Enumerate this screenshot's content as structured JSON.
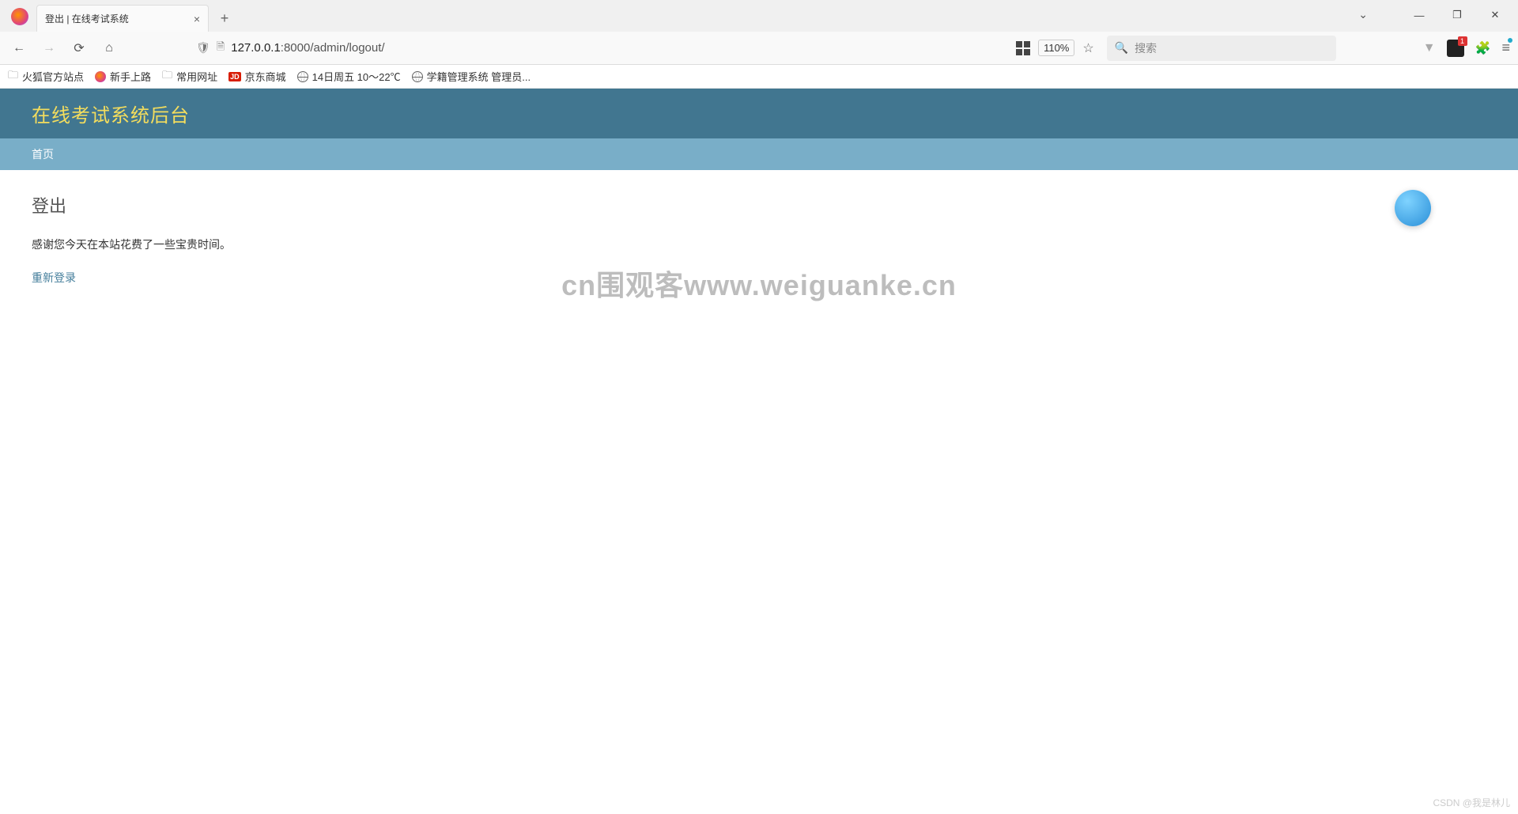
{
  "browser": {
    "tab_title": "登出 | 在线考试系统",
    "url_host": "127.0.0.1",
    "url_port_path": ":8000/admin/logout/",
    "zoom": "110%",
    "search_placeholder": "搜索",
    "ext_badge": "1"
  },
  "bookmarks": [
    {
      "label": "火狐官方站点",
      "type": "folder"
    },
    {
      "label": "新手上路",
      "type": "ff"
    },
    {
      "label": "常用网址",
      "type": "folder"
    },
    {
      "label": "京东商城",
      "type": "jd"
    },
    {
      "label": "14日周五  10～22℃",
      "type": "globe"
    },
    {
      "label": "学籍管理系统 管理员...",
      "type": "globe"
    }
  ],
  "page": {
    "site_title": "在线考试系统后台",
    "nav_home": "首页",
    "heading": "登出",
    "message": "感谢您今天在本站花费了一些宝贵时间。",
    "relogin": "重新登录"
  },
  "watermark": "cn围观客www.weiguanke.cn",
  "footer": "CSDN @我是林儿"
}
